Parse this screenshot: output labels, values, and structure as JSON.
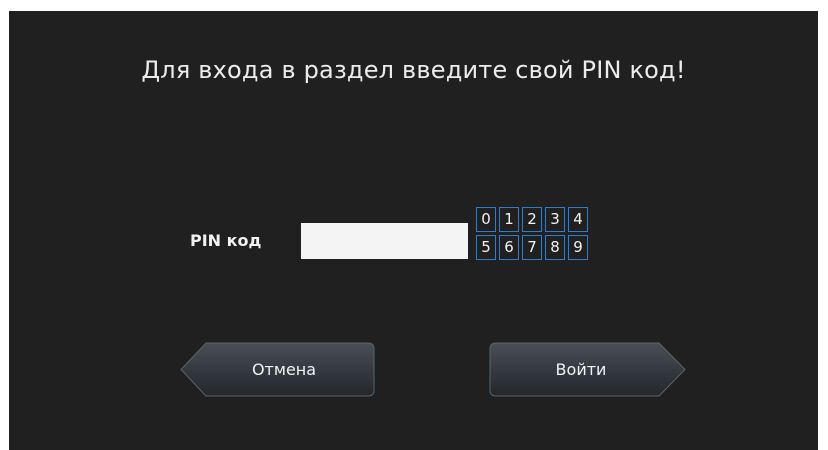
{
  "prompt": "Для входа в раздел введите свой PIN код!",
  "pin": {
    "label": "PIN код",
    "value": ""
  },
  "keypad": {
    "keys": [
      "0",
      "1",
      "2",
      "3",
      "4",
      "5",
      "6",
      "7",
      "8",
      "9"
    ]
  },
  "buttons": {
    "cancel_label": "Отмена",
    "login_label": "Войти"
  },
  "colors": {
    "background": "#202020",
    "key_border": "#2a7fd0",
    "text": "#f2f2f2"
  }
}
